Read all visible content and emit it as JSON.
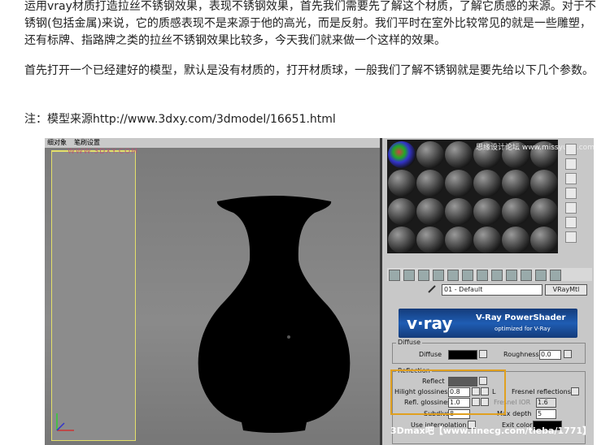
{
  "article": {
    "p1": "运用vray材质打造拉丝不锈钢效果，表现不锈钢效果，首先我们需要先了解这个材质，了解它质感的来源。对于不锈钢(包括金属)来说，它的质感表现不是来源于他的高光，而是反射。我们平时在室外比较常见的就是一些雕塑，还有标牌、指路牌之类的拉丝不锈钢效果比较多，今天我们就来做一个这样的效果。",
    "p2": "首先打开一个已经建好的模型，默认是没有材质的，打开材质球，一般我们了解不锈钢就是要先给以下几个参数。",
    "p3": "注：模型来源http://www.3dxy.com/3dmodel/16651.html"
  },
  "screenshot": {
    "viewport": {
      "menu_items": [
        "细对象",
        "笔刷设置"
      ],
      "watermark": "WWW.3DXY.COM"
    },
    "material_editor": {
      "watermark": "思缘设计论坛 www.missyuan.com",
      "material_name": "01 - Default",
      "material_type": "VRayMtl",
      "vray_logo": "v·ray",
      "vray_title": "V-Ray PowerShader",
      "vray_subtitle": "optimized for V-Ray",
      "diffuse_group": "Diffuse",
      "diffuse_label": "Diffuse",
      "roughness_label": "Roughness",
      "roughness_value": "0.0",
      "reflection_group": "Reflection",
      "reflect_label": "Reflect",
      "hilight_label": "Hilight glossiness",
      "hilight_value": "0.8",
      "refl_label": "Refl. glossiness",
      "refl_value": "1.0",
      "lock_label": "L",
      "fresnel_label": "Fresnel reflections",
      "fresnel_ior_label": "Fresnel IOR",
      "fresnel_ior_value": "1.6",
      "subdivs_label": "Subdivs",
      "subdivs_value": "8",
      "maxdepth_label": "Max depth",
      "maxdepth_value": "5",
      "interp_label": "Use interpolation",
      "exitcolor_label": "Exit color"
    },
    "bottom_watermark": "3Dmax吧【www.linecg.com/tieba/1771】",
    "colors": {
      "diffuse": "#000000",
      "reflect": "#5a5a5a",
      "highlight_box": "#e0a020"
    }
  }
}
